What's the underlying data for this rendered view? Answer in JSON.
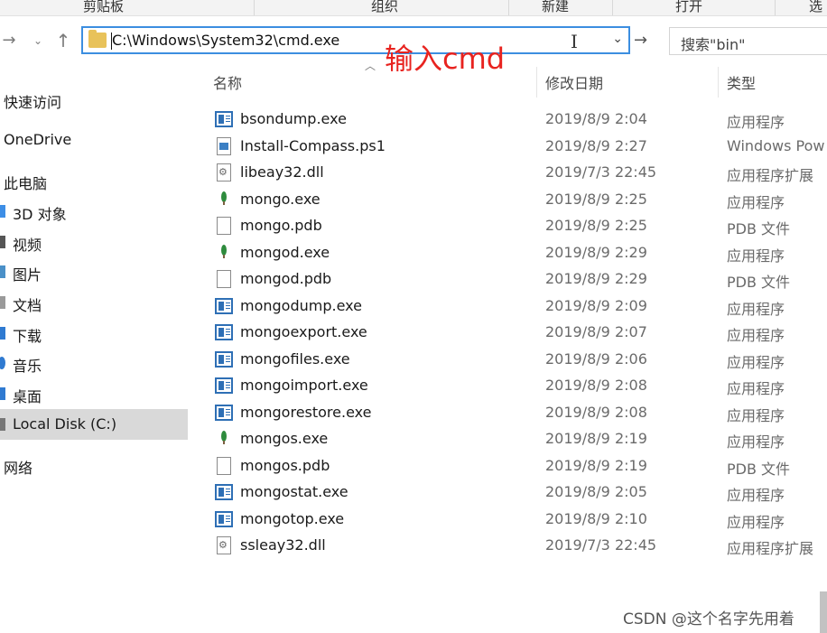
{
  "ribbon": {
    "groups": [
      "剪贴板",
      "组织",
      "新建",
      "打开",
      "选"
    ]
  },
  "address_bar": {
    "value": "C:\\Windows\\System32\\cmd.exe"
  },
  "search": {
    "placeholder": "搜索\"bin\""
  },
  "annotation": "输入cmd",
  "columns": {
    "name": "名称",
    "modified": "修改日期",
    "type": "类型"
  },
  "sidebar": {
    "items": [
      {
        "label": "快速访问",
        "icon": "star-icon"
      },
      {
        "label": "OneDrive",
        "icon": "cloud-icon"
      },
      {
        "label": "此电脑",
        "icon": "computer-icon"
      },
      {
        "label": "3D 对象",
        "icon": "cube-icon"
      },
      {
        "label": "视频",
        "icon": "video-icon"
      },
      {
        "label": "图片",
        "icon": "picture-icon"
      },
      {
        "label": "文档",
        "icon": "document-icon"
      },
      {
        "label": "下载",
        "icon": "download-icon"
      },
      {
        "label": "音乐",
        "icon": "music-icon"
      },
      {
        "label": "桌面",
        "icon": "desktop-icon"
      },
      {
        "label": "Local Disk (C:)",
        "icon": "drive-icon"
      },
      {
        "label": "网络",
        "icon": "network-icon"
      }
    ]
  },
  "files": [
    {
      "name": "bsondump.exe",
      "date": "2019/8/9 2:04",
      "type": "应用程序",
      "icon": "exe-icon"
    },
    {
      "name": "Install-Compass.ps1",
      "date": "2019/8/9 2:27",
      "type": "Windows Pow",
      "icon": "powershell-icon"
    },
    {
      "name": "libeay32.dll",
      "date": "2019/7/3 22:45",
      "type": "应用程序扩展",
      "icon": "dll-icon"
    },
    {
      "name": "mongo.exe",
      "date": "2019/8/9 2:25",
      "type": "应用程序",
      "icon": "mongo-leaf-icon"
    },
    {
      "name": "mongo.pdb",
      "date": "2019/8/9 2:25",
      "type": "PDB 文件",
      "icon": "file-icon"
    },
    {
      "name": "mongod.exe",
      "date": "2019/8/9 2:29",
      "type": "应用程序",
      "icon": "mongo-leaf-icon"
    },
    {
      "name": "mongod.pdb",
      "date": "2019/8/9 2:29",
      "type": "PDB 文件",
      "icon": "file-icon"
    },
    {
      "name": "mongodump.exe",
      "date": "2019/8/9 2:09",
      "type": "应用程序",
      "icon": "exe-icon"
    },
    {
      "name": "mongoexport.exe",
      "date": "2019/8/9 2:07",
      "type": "应用程序",
      "icon": "exe-icon"
    },
    {
      "name": "mongofiles.exe",
      "date": "2019/8/9 2:06",
      "type": "应用程序",
      "icon": "exe-icon"
    },
    {
      "name": "mongoimport.exe",
      "date": "2019/8/9 2:08",
      "type": "应用程序",
      "icon": "exe-icon"
    },
    {
      "name": "mongorestore.exe",
      "date": "2019/8/9 2:08",
      "type": "应用程序",
      "icon": "exe-icon"
    },
    {
      "name": "mongos.exe",
      "date": "2019/8/9 2:19",
      "type": "应用程序",
      "icon": "mongo-leaf-icon"
    },
    {
      "name": "mongos.pdb",
      "date": "2019/8/9 2:19",
      "type": "PDB 文件",
      "icon": "file-icon"
    },
    {
      "name": "mongostat.exe",
      "date": "2019/8/9 2:05",
      "type": "应用程序",
      "icon": "exe-icon"
    },
    {
      "name": "mongotop.exe",
      "date": "2019/8/9 2:10",
      "type": "应用程序",
      "icon": "exe-icon"
    },
    {
      "name": "ssleay32.dll",
      "date": "2019/7/3 22:45",
      "type": "应用程序扩展",
      "icon": "dll-icon"
    }
  ],
  "watermark": "CSDN @这个名字先用着",
  "colors": {
    "accent": "#3c8ee0",
    "annotation": "#e8231f",
    "selected": "#d9d9d9"
  }
}
